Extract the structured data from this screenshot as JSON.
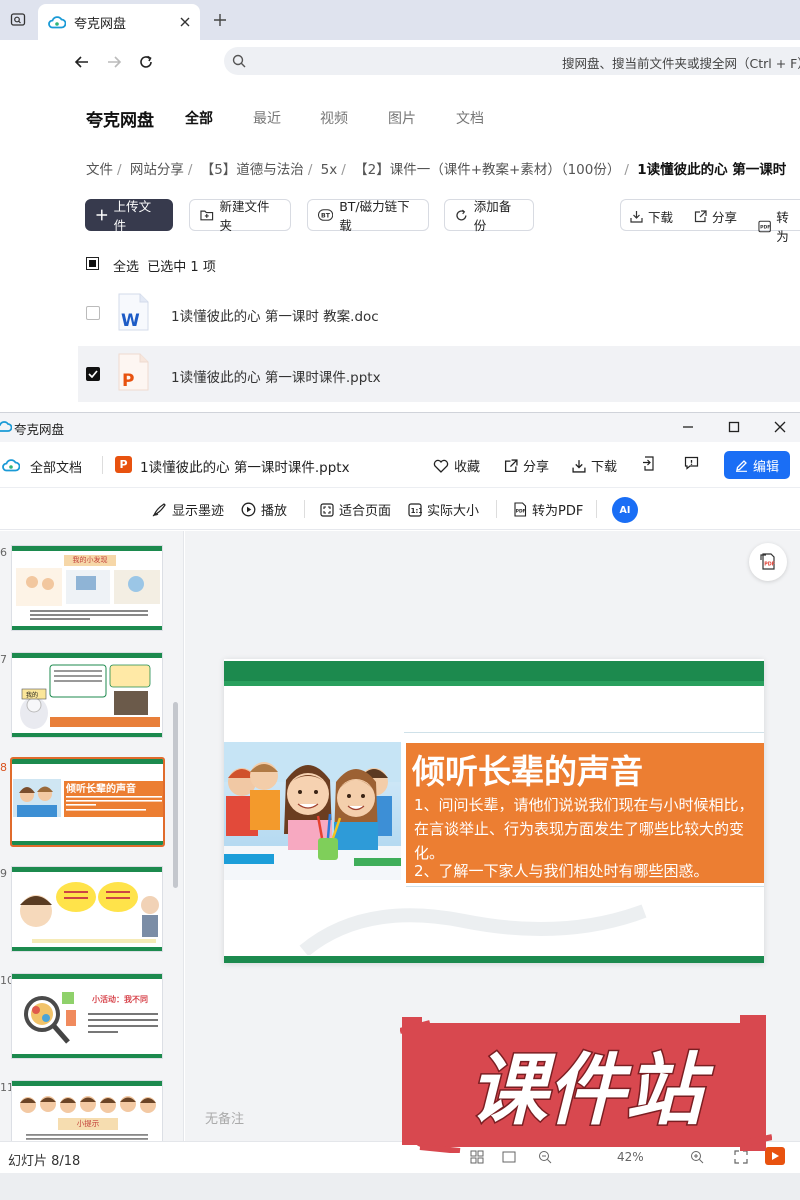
{
  "browser": {
    "tab_title": "夸克网盘",
    "address_placeholder": "搜网盘、搜当前文件夹或搜全网（Ctrl + F）"
  },
  "drive": {
    "brand": "夸克网盘",
    "category_tabs": [
      "全部",
      "最近",
      "视频",
      "图片",
      "文档"
    ],
    "breadcrumb": [
      "文件",
      "网站分享",
      "【5】道德与法治",
      "5x",
      "【2】课件一（课件+教案+素材）（100份）",
      "1读懂彼此的心 第一课时"
    ],
    "buttons": {
      "upload": "上传文件",
      "new_folder": "新建文件夹",
      "bt_download": "BT/磁力链下载",
      "add_backup": "添加备份",
      "download": "下载",
      "share": "分享",
      "to_pdf": "转为"
    },
    "select_all": "全选",
    "selected_info": "已选中 1 项",
    "files": [
      {
        "name": "1读懂彼此的心  第一课时 教案.doc",
        "type_badge": "W",
        "checked": false
      },
      {
        "name": "1读懂彼此的心  第一课时课件.pptx",
        "type_badge": "P",
        "checked": true
      }
    ]
  },
  "viewer": {
    "app_title": "夸克网盘",
    "all_docs": "全部文档",
    "doc_name": "1读懂彼此的心 第一课时课件.pptx",
    "doc_badge": "P",
    "header_actions": {
      "favorite": "收藏",
      "share": "分享",
      "download": "下载",
      "edit": "编辑"
    },
    "toolbar": {
      "show_ink": "显示墨迹",
      "play": "播放",
      "fit_page": "适合页面",
      "actual_size": "实际大小",
      "to_pdf": "转为PDF",
      "ai": "AI"
    },
    "thumbnails": [
      {
        "number": "6",
        "title": "我的小发现"
      },
      {
        "number": "7",
        "title": "我的小发现"
      },
      {
        "number": "8",
        "title": "倾听长辈的声音",
        "active": true
      },
      {
        "number": "9",
        "title": ""
      },
      {
        "number": "10",
        "title": "小活动：我不同"
      },
      {
        "number": "11",
        "title": "小提示"
      }
    ],
    "slide": {
      "heading": "倾听长辈的声音",
      "lines": [
        "1、问问长辈，请他们说说我们现在与小时候相比，",
        "在言谈举止、行为表现方面发生了哪些比较大的变",
        "化。",
        "2、了解一下家人与我们相处时有哪些困惑。"
      ]
    },
    "notes_placeholder": "无备注",
    "status": {
      "slide_counter": "幻灯片 8/18",
      "zoom": "42%"
    },
    "watermark": "课件站"
  },
  "colors": {
    "accent_blue": "#1a6ef5",
    "slide_green": "#1c8a4e",
    "slide_orange": "#ec7e32",
    "watermark_red": "#d8484f",
    "ppt_orange": "#e8520f",
    "word_blue": "#1d5bc6"
  }
}
